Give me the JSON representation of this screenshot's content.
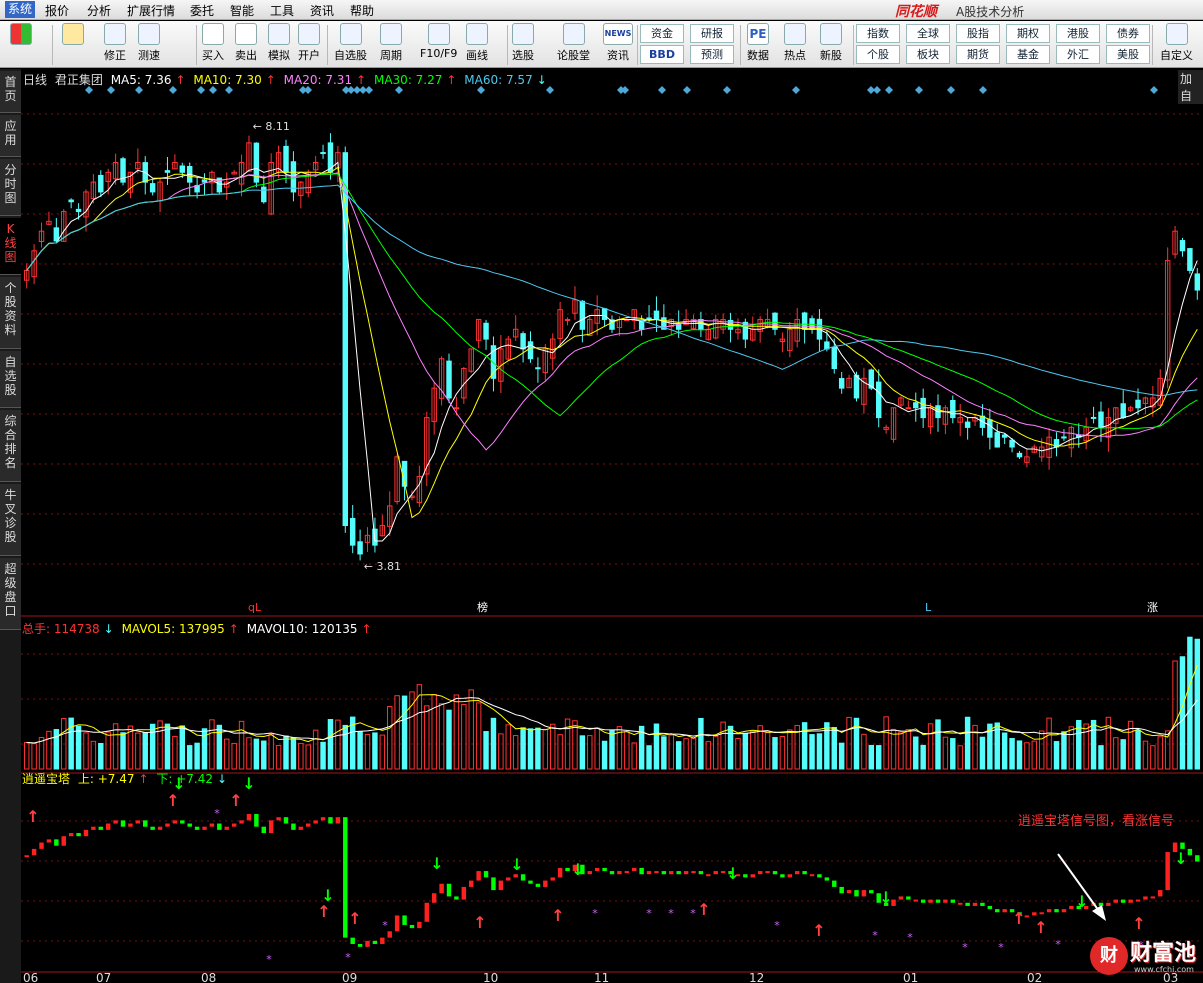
{
  "menubar": {
    "items": [
      "系统",
      "报价",
      "分析",
      "扩展行情",
      "委托",
      "智能",
      "工具",
      "资讯",
      "帮助"
    ],
    "brand": "同花顺",
    "brand_sub": "A股技术分析"
  },
  "toolbar": {
    "buttons": [
      {
        "label": "",
        "icon": "grid-icon"
      },
      {
        "label": "",
        "icon": "back-arrow-icon"
      },
      {
        "label": "修正",
        "icon": "updown-icon"
      },
      {
        "label": "测速",
        "icon": "speed-icon"
      },
      {
        "label": "买入",
        "icon": "buy-icon",
        "glyph": "买"
      },
      {
        "label": "卖出",
        "icon": "sell-icon",
        "glyph": "卖"
      },
      {
        "label": "模拟",
        "icon": "hammer-icon"
      },
      {
        "label": "开户",
        "icon": "lock-icon"
      },
      {
        "label": "自选股",
        "icon": "star-icon"
      },
      {
        "label": "周期",
        "icon": "clock-icon"
      },
      {
        "label": "F10/F9",
        "icon": "doc-icon"
      },
      {
        "label": "画线",
        "icon": "pen-icon"
      },
      {
        "label": "选股",
        "icon": "monitor-icon"
      },
      {
        "label": "论股堂",
        "icon": "talk-icon"
      },
      {
        "label": "资讯",
        "icon": "news-icon",
        "glyph": "NEWS"
      },
      {
        "label": "数据",
        "icon": "pe-icon",
        "glyph": "PE"
      },
      {
        "label": "热点",
        "icon": "hot-icon"
      },
      {
        "label": "新股",
        "icon": "ipo-icon"
      },
      {
        "label": "自定义",
        "icon": "custom-icon"
      }
    ],
    "small_buttons": [
      "资金",
      "BBD",
      "研报",
      "预测",
      "指数",
      "全球",
      "股指",
      "期权",
      "港股",
      "债券",
      "个股",
      "板块",
      "期货",
      "基金",
      "外汇",
      "美股"
    ]
  },
  "sidebar": {
    "tabs": [
      "首页",
      "应用",
      "分时图",
      "K线图",
      "个股资料",
      "自选股",
      "综合排名",
      "牛叉诊股",
      "超级盘口"
    ],
    "active": 3,
    "add_tab": "加自"
  },
  "legend_price": {
    "period": "日线",
    "name": "君正集团",
    "ma5": "MA5: 7.36",
    "ma10": "MA10: 7.30",
    "ma20": "MA20: 7.31",
    "ma30": "MA30: 7.27",
    "ma60": "MA60: 7.57"
  },
  "legend_vol": {
    "total": "总手: 114738",
    "mavol5": "MAVOL5: 137995",
    "mavol10": "MAVOL10: 120135"
  },
  "legend_ind": {
    "name": "逍遥宝塔",
    "up": "上: +7.47",
    "down": "下: +7.42"
  },
  "annotation": "逍遥宝塔信号图，看涨信号",
  "watermark": {
    "glyph": "财",
    "text": "财富池",
    "url": "www.cfchi.com"
  },
  "colors": {
    "up": "#ff3232",
    "down": "#54fcfc",
    "ma5": "#ffffff",
    "ma10": "#ffff00",
    "ma20": "#ff80ff",
    "ma30": "#00ff00",
    "ma60": "#4ec8f0",
    "grid": "#7a1010"
  },
  "chart_data": {
    "type": "candlestick",
    "x_labels": [
      "06",
      "07",
      "08",
      "09",
      "10",
      "11",
      "12",
      "01",
      "02",
      "03"
    ],
    "high_label": "8.11",
    "low_label": "3.81",
    "event_marks": [
      "qL",
      "榜",
      "L",
      "涨"
    ],
    "closes": [
      6.7,
      6.9,
      7.1,
      7.2,
      7.0,
      7.3,
      7.4,
      7.3,
      7.5,
      7.6,
      7.5,
      7.7,
      7.8,
      7.6,
      7.7,
      7.8,
      7.6,
      7.5,
      7.6,
      7.7,
      7.8,
      7.7,
      7.6,
      7.5,
      7.6,
      7.7,
      7.5,
      7.6,
      7.7,
      7.8,
      8.0,
      7.6,
      7.4,
      7.8,
      7.9,
      7.7,
      7.5,
      7.6,
      7.7,
      7.8,
      7.9,
      7.7,
      7.9,
      4.1,
      3.9,
      3.81,
      4.0,
      3.9,
      4.1,
      4.3,
      4.8,
      4.5,
      4.4,
      4.6,
      5.2,
      5.5,
      5.8,
      5.4,
      5.3,
      5.7,
      5.9,
      6.2,
      6.0,
      5.6,
      5.9,
      6.0,
      6.1,
      5.9,
      5.8,
      5.7,
      5.9,
      6.0,
      6.3,
      6.2,
      6.4,
      6.1,
      6.2,
      6.3,
      6.2,
      6.1,
      6.2,
      6.2,
      6.3,
      6.1,
      6.2,
      6.2,
      6.1,
      6.2,
      6.1,
      6.2,
      6.2,
      6.1,
      6.1,
      6.2,
      6.2,
      6.1,
      6.1,
      6.0,
      6.1,
      6.2,
      6.2,
      6.1,
      6.0,
      6.1,
      6.2,
      6.1,
      6.1,
      6.0,
      5.9,
      5.7,
      5.5,
      5.6,
      5.4,
      5.6,
      5.5,
      5.2,
      5.1,
      5.3,
      5.4,
      5.3,
      5.3,
      5.2,
      5.3,
      5.2,
      5.3,
      5.2,
      5.2,
      5.1,
      5.2,
      5.1,
      5.0,
      4.9,
      5.0,
      4.9,
      4.8,
      4.8,
      4.9,
      4.9,
      5.0,
      4.9,
      5.0,
      5.1,
      5.0,
      5.1,
      5.2,
      5.1,
      5.2,
      5.3,
      5.2,
      5.3,
      5.3,
      5.4,
      5.4,
      5.6,
      6.8,
      7.1,
      6.9,
      6.7,
      6.5
    ],
    "ylim": [
      3.3,
      8.6
    ]
  }
}
